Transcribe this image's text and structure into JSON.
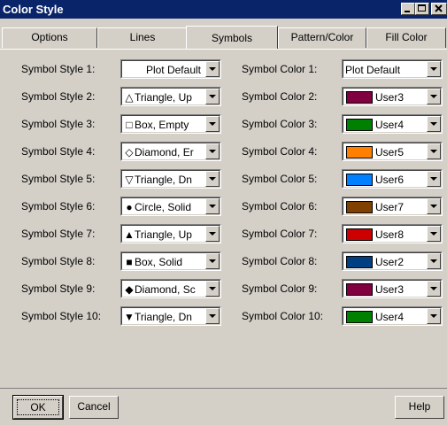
{
  "window": {
    "title": "Color Style"
  },
  "tabs": [
    {
      "label": "Options"
    },
    {
      "label": "Lines"
    },
    {
      "label": "Symbols",
      "active": true
    },
    {
      "label": "Pattern/Color"
    },
    {
      "label": "Fill Color"
    }
  ],
  "symbol_styles": [
    {
      "label": "Symbol Style 1:",
      "glyph": "",
      "value": "Plot Default"
    },
    {
      "label": "Symbol Style 2:",
      "glyph": "△",
      "value": "Triangle, Up"
    },
    {
      "label": "Symbol Style 3:",
      "glyph": "□",
      "value": "Box, Empty"
    },
    {
      "label": "Symbol Style 4:",
      "glyph": "◇",
      "value": "Diamond, Er"
    },
    {
      "label": "Symbol Style 5:",
      "glyph": "▽",
      "value": "Triangle, Dn"
    },
    {
      "label": "Symbol Style 6:",
      "glyph": "●",
      "value": "Circle, Solid"
    },
    {
      "label": "Symbol Style 7:",
      "glyph": "▲",
      "value": "Triangle, Up"
    },
    {
      "label": "Symbol Style 8:",
      "glyph": "■",
      "value": "Box, Solid"
    },
    {
      "label": "Symbol Style 9:",
      "glyph": "◆",
      "value": "Diamond, Sc"
    },
    {
      "label": "Symbol Style 10:",
      "glyph": "▼",
      "value": "Triangle, Dn"
    }
  ],
  "symbol_colors": [
    {
      "label": "Symbol Color 1:",
      "value": "Plot Default",
      "color": ""
    },
    {
      "label": "Symbol Color 2:",
      "value": "User3",
      "color": "#800040"
    },
    {
      "label": "Symbol Color 3:",
      "value": "User4",
      "color": "#008000"
    },
    {
      "label": "Symbol Color 4:",
      "value": "User5",
      "color": "#ff8000"
    },
    {
      "label": "Symbol Color 5:",
      "value": "User6",
      "color": "#0080ff"
    },
    {
      "label": "Symbol Color 6:",
      "value": "User7",
      "color": "#804000"
    },
    {
      "label": "Symbol Color 7:",
      "value": "User8",
      "color": "#cc0000"
    },
    {
      "label": "Symbol Color 8:",
      "value": "User2",
      "color": "#004080"
    },
    {
      "label": "Symbol Color 9:",
      "value": "User3",
      "color": "#800040"
    },
    {
      "label": "Symbol Color 10:",
      "value": "User4",
      "color": "#008000"
    }
  ],
  "buttons": {
    "ok": "OK",
    "cancel": "Cancel",
    "help": "Help"
  }
}
